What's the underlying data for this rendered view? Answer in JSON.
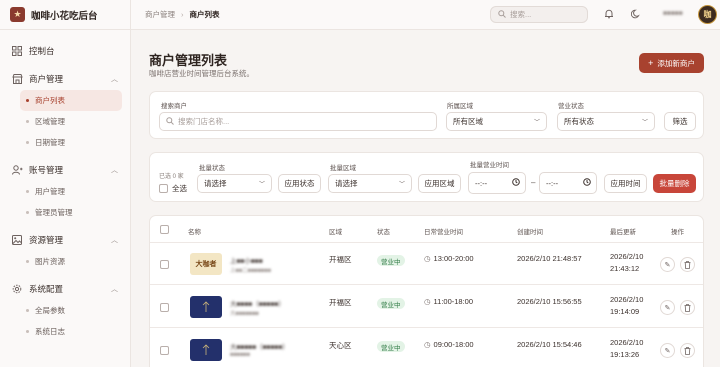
{
  "brand": {
    "name": "咖啡小花吃后台",
    "logo_char": "★"
  },
  "sidebar": {
    "groups": [
      {
        "label": "控制台",
        "icon": "dashboard-icon",
        "items": []
      },
      {
        "label": "商户管理",
        "icon": "store-icon",
        "items": [
          {
            "label": "商户列表",
            "active": true
          },
          {
            "label": "区域管理"
          },
          {
            "label": "日期管理"
          }
        ]
      },
      {
        "label": "账号管理",
        "icon": "user-icon",
        "items": [
          {
            "label": "用户管理"
          },
          {
            "label": "管理员管理"
          }
        ]
      },
      {
        "label": "资源管理",
        "icon": "image-icon",
        "items": [
          {
            "label": "图片资源"
          }
        ]
      },
      {
        "label": "系统配置",
        "icon": "gear-icon",
        "items": [
          {
            "label": "全局参数"
          },
          {
            "label": "系统日志"
          }
        ]
      }
    ]
  },
  "header": {
    "breadcrumb": [
      "商户管理",
      "商户列表"
    ],
    "search_placeholder": "搜索...",
    "user_name": "■■■■■",
    "avatar_text": "咖"
  },
  "page": {
    "title": "商户管理列表",
    "subtitle": "咖啡店营业时间管理后台系统。",
    "add_button": "添加新商户"
  },
  "filters": {
    "search_label": "搜索商户",
    "search_placeholder": "搜索门店名称...",
    "region_label": "所属区域",
    "region_value": "所有区域",
    "status_label": "营业状态",
    "status_value": "所有状态",
    "filter_button": "筛选"
  },
  "bulk": {
    "selected_count": "已选 0 家",
    "select_all": "全选",
    "status_label": "批量状态",
    "status_value": "请选择",
    "apply_status": "应用状态",
    "region_label": "批量区域",
    "region_value": "请选择",
    "apply_region": "应用区域",
    "time_label": "批量营业时间",
    "time_start": "--:--",
    "time_sep": "–",
    "time_end": "--:--",
    "apply_time": "应用时间",
    "delete": "批量删除"
  },
  "table": {
    "columns": [
      "名称",
      "区域",
      "状态",
      "日常营业时间",
      "创建时间",
      "最后更新",
      "操作"
    ],
    "rows": [
      {
        "name": "上■■小■■■",
        "sub": "上■■二■■■■■■■",
        "region": "开福区",
        "status": "营业中",
        "hours": "13:00-20:00",
        "created": "2026/2/10 21:48:57",
        "updated_date": "2026/2/10",
        "updated_time": "21:43:12",
        "thumb": "#f3e6c4",
        "thumb_text": "大咖者"
      },
      {
        "name": "大■■■■（■■■■■）",
        "sub": "大■■■■■■■",
        "region": "开福区",
        "status": "营业中",
        "hours": "11:00-18:00",
        "created": "2026/2/10 15:56:55",
        "updated_date": "2026/2/10",
        "updated_time": "19:14:09",
        "thumb": "#23306b",
        "thumb_text": ""
      },
      {
        "name": "大■■■■■（■■■■■）",
        "sub": "■■■■■■",
        "region": "天心区",
        "status": "营业中",
        "hours": "09:00-18:00",
        "created": "2026/2/10 15:54:46",
        "updated_date": "2026/2/10",
        "updated_time": "19:13:26",
        "thumb": "#23306b",
        "thumb_text": ""
      }
    ]
  }
}
